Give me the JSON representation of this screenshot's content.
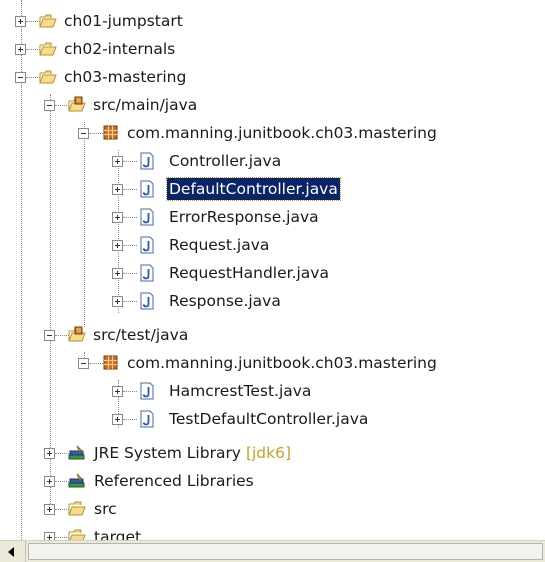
{
  "tree": {
    "items": [
      {
        "label": "ch01-jumpstart",
        "icon": "folder-open-icon",
        "expanded": false
      },
      {
        "label": "ch02-internals",
        "icon": "folder-open-icon",
        "expanded": false
      },
      {
        "label": "ch03-mastering",
        "icon": "folder-open-icon",
        "expanded": true
      },
      {
        "label": "src/main/java",
        "icon": "source-folder-icon",
        "expanded": true
      },
      {
        "label": "com.manning.junitbook.ch03.mastering",
        "icon": "package-icon",
        "expanded": true
      },
      {
        "label": "Controller.java",
        "icon": "java-file-icon",
        "expanded": false
      },
      {
        "label": "DefaultController.java",
        "icon": "java-file-icon",
        "expanded": false,
        "selected": true
      },
      {
        "label": "ErrorResponse.java",
        "icon": "java-file-icon",
        "expanded": false
      },
      {
        "label": "Request.java",
        "icon": "java-file-icon",
        "expanded": false
      },
      {
        "label": "RequestHandler.java",
        "icon": "java-file-icon",
        "expanded": false
      },
      {
        "label": "Response.java",
        "icon": "java-file-icon",
        "expanded": false
      },
      {
        "label": "src/test/java",
        "icon": "source-folder-icon",
        "expanded": true
      },
      {
        "label": "com.manning.junitbook.ch03.mastering",
        "icon": "package-icon",
        "expanded": true
      },
      {
        "label": "HamcrestTest.java",
        "icon": "java-file-icon",
        "expanded": false
      },
      {
        "label": "TestDefaultController.java",
        "icon": "java-file-icon",
        "expanded": false
      },
      {
        "label": "JRE System Library",
        "decoration": "[jdk6]",
        "icon": "library-icon",
        "expanded": false
      },
      {
        "label": "Referenced Libraries",
        "icon": "library-icon",
        "expanded": false
      },
      {
        "label": "src",
        "icon": "folder-icon",
        "expanded": false
      },
      {
        "label": "target",
        "icon": "folder-icon",
        "expanded": false
      }
    ],
    "selection_color": "#0a246a",
    "decoration_color": "#c8a028"
  }
}
